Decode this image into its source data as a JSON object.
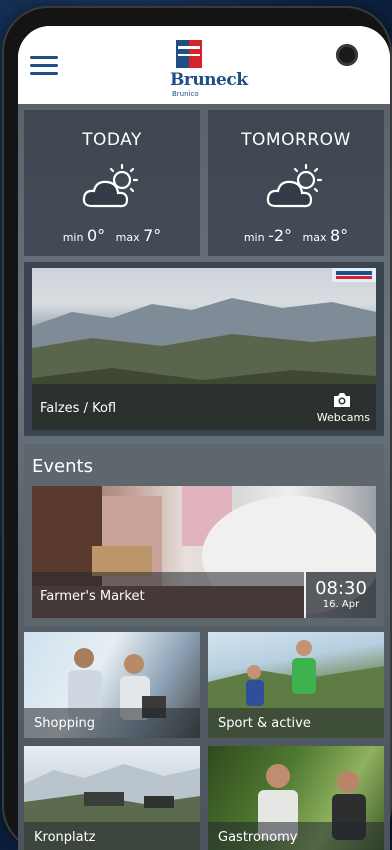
{
  "app": {
    "logo_text": "Bruneck",
    "logo_subtext": "Brunico"
  },
  "weather": {
    "today": {
      "title": "TODAY",
      "icon": "partly-cloudy-icon",
      "min_label": "min",
      "min_value": "0°",
      "max_label": "max",
      "max_value": "7°"
    },
    "tomorrow": {
      "title": "TOMORROW",
      "icon": "partly-cloudy-icon",
      "min_label": "min",
      "min_value": "-2°",
      "max_label": "max",
      "max_value": "8°"
    }
  },
  "webcam": {
    "location": "Falzes / Kofl",
    "label": "Webcams",
    "icon": "camera-icon"
  },
  "events": {
    "title": "Events",
    "featured": {
      "name": "Farmer's Market",
      "time": "08:30",
      "date": "16. Apr"
    }
  },
  "tiles": [
    {
      "label": "Shopping"
    },
    {
      "label": "Sport & active"
    },
    {
      "label": "Kronplatz"
    },
    {
      "label": "Gastronomy"
    }
  ],
  "colors": {
    "brand_blue": "#1e4f86",
    "brand_red": "#d4232d",
    "overlay": "#23282e"
  }
}
